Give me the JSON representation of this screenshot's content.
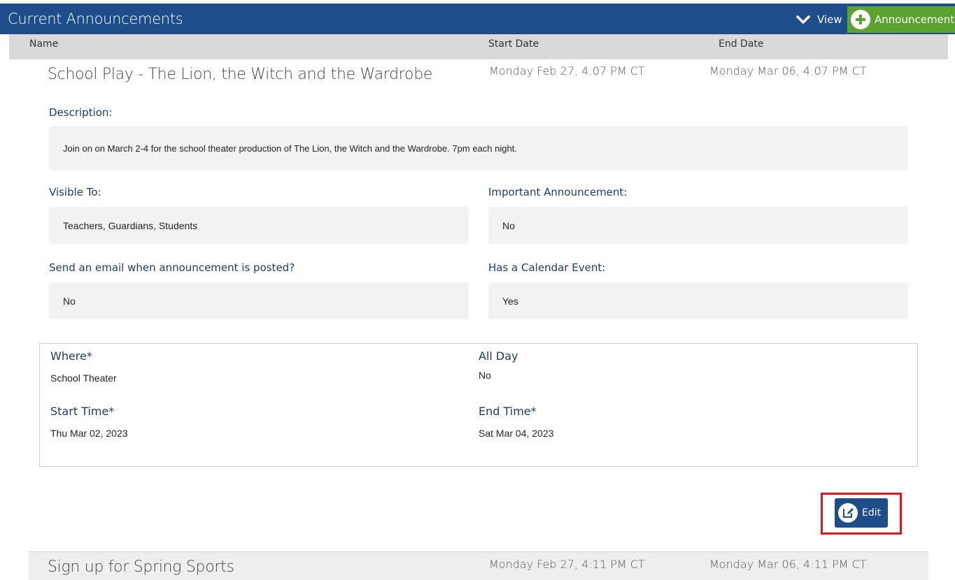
{
  "header": {
    "title": "Current Announcements",
    "view_label": "View",
    "add_label": "Announcement",
    "color": "#1e4d8c",
    "add_color": "#5aa32e"
  },
  "columns": {
    "name": "Name",
    "start": "Start Date",
    "end": "End Date"
  },
  "announcement": {
    "title": "School Play - The Lion, the Witch and the Wardrobe",
    "start": "Monday Feb 27, 4:07 PM CT",
    "end": "Monday Mar 06, 4:07 PM CT",
    "description_label": "Description:",
    "description": "Join on on March 2-4 for the school theater production of The Lion, the Witch and the Wardrobe. 7pm each night.",
    "visible_label": "Visible To:",
    "visible": "Teachers, Guardians, Students",
    "important_label": "Important Announcement:",
    "important": "No",
    "email_label": "Send an email when announcement is posted?",
    "email": "No",
    "calendar_label": "Has a Calendar Event:",
    "calendar": "Yes",
    "event": {
      "where_label": "Where*",
      "where": "School Theater",
      "allday_label": "All Day",
      "allday": "No",
      "start_label": "Start Time*",
      "start": "Thu Mar 02, 2023",
      "end_label": "End Time*",
      "end": "Sat Mar 04, 2023"
    },
    "edit_label": "Edit"
  },
  "next_announcement": {
    "title": "Sign up for Spring Sports",
    "start": "Monday Feb 27, 4:11 PM CT",
    "end": "Monday Mar 06, 4:11 PM CT"
  },
  "icons": {
    "view_toggle": "chevron-down-icon",
    "add": "plus-circle-icon",
    "edit": "edit-icon"
  }
}
